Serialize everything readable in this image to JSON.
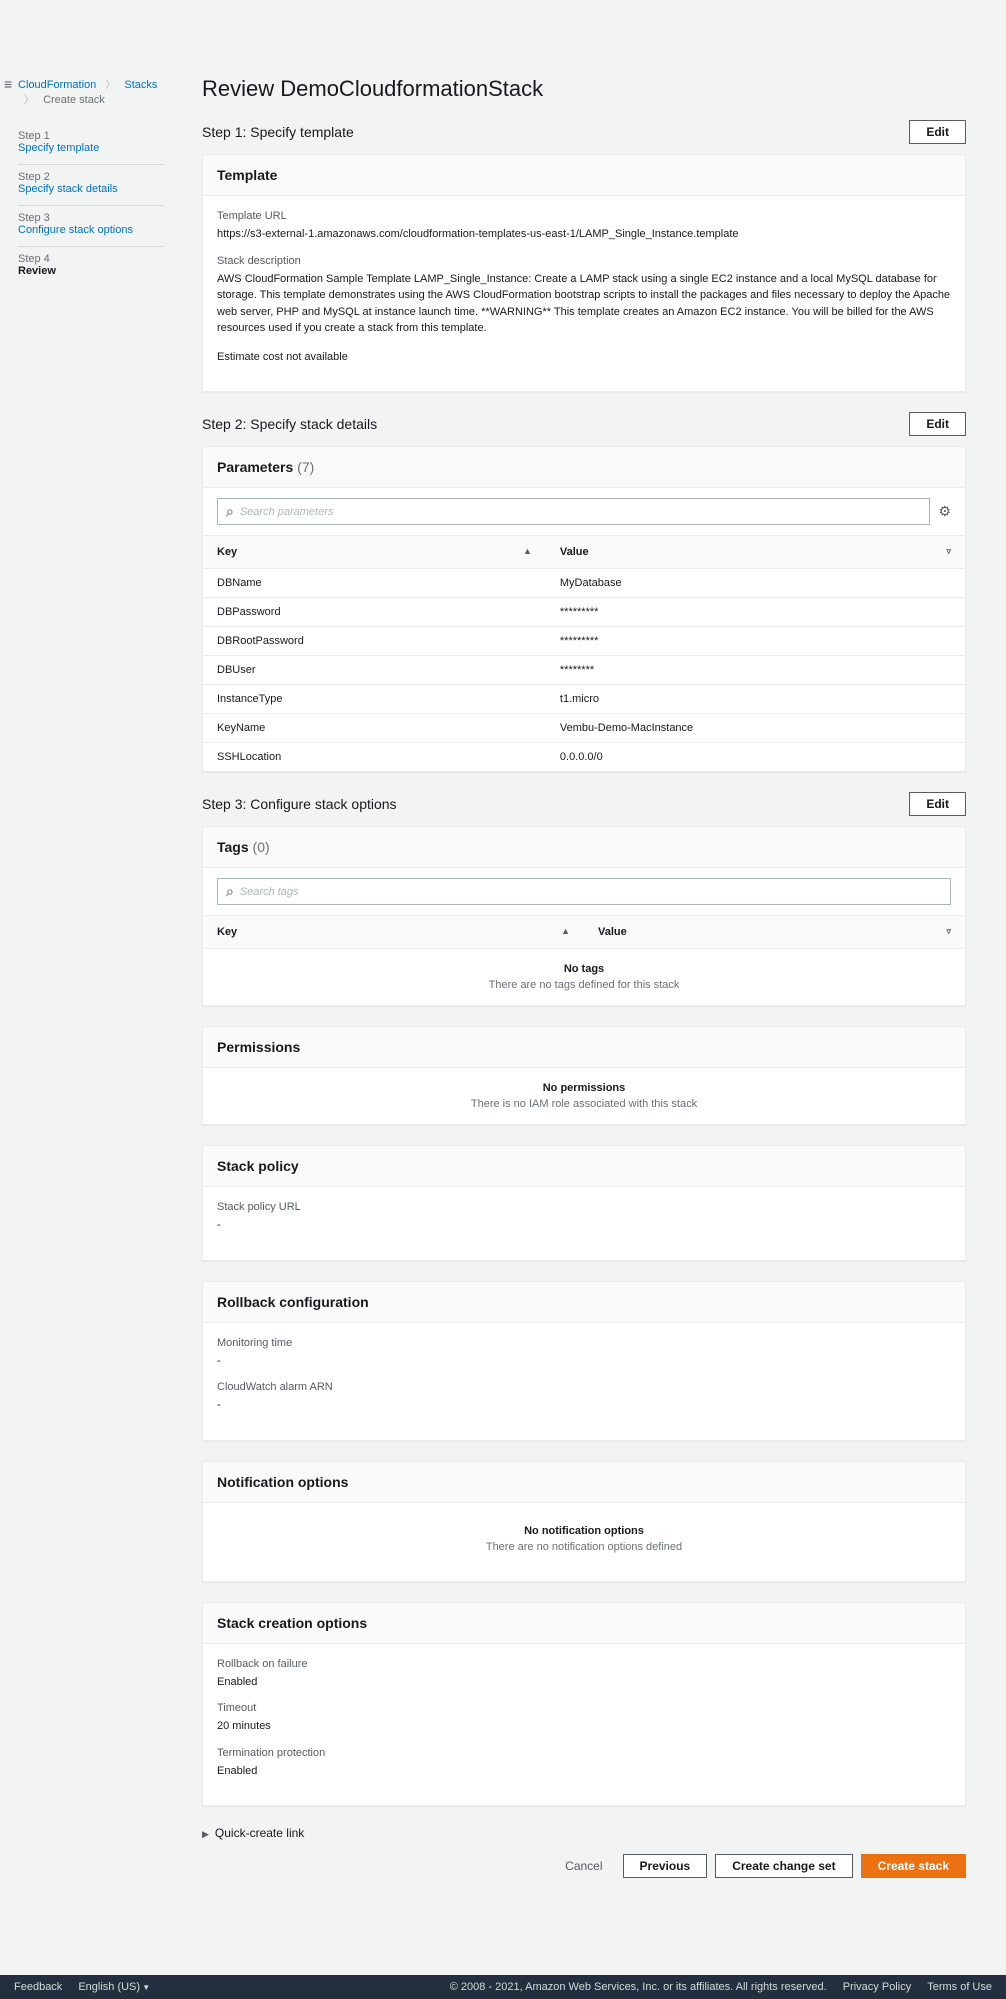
{
  "breadcrumb": {
    "cloudformation": "CloudFormation",
    "stacks": "Stacks",
    "current": "Create stack"
  },
  "steps": [
    {
      "num": "Step 1",
      "label": "Specify template"
    },
    {
      "num": "Step 2",
      "label": "Specify stack details"
    },
    {
      "num": "Step 3",
      "label": "Configure stack options"
    },
    {
      "num": "Step 4",
      "label": "Review"
    }
  ],
  "title": "Review DemoCloudformationStack",
  "step1": {
    "heading": "Step 1: Specify template",
    "edit": "Edit",
    "panel_title": "Template",
    "url_label": "Template URL",
    "url_value": "https://s3-external-1.amazonaws.com/cloudformation-templates-us-east-1/LAMP_Single_Instance.template",
    "desc_label": "Stack description",
    "desc_value": "AWS CloudFormation Sample Template LAMP_Single_Instance: Create a LAMP stack using a single EC2 instance and a local MySQL database for storage. This template demonstrates using the AWS CloudFormation bootstrap scripts to install the packages and files necessary to deploy the Apache web server, PHP and MySQL at instance launch time. **WARNING** This template creates an Amazon EC2 instance. You will be billed for the AWS resources used if you create a stack from this template.",
    "estimate": "Estimate cost not available"
  },
  "step2": {
    "heading": "Step 2: Specify stack details",
    "edit": "Edit",
    "panel_title": "Parameters",
    "count": "(7)",
    "search_placeholder": "Search parameters",
    "key_header": "Key",
    "value_header": "Value",
    "rows": [
      {
        "key": "DBName",
        "value": "MyDatabase"
      },
      {
        "key": "DBPassword",
        "value": "*********"
      },
      {
        "key": "DBRootPassword",
        "value": "*********"
      },
      {
        "key": "DBUser",
        "value": "********"
      },
      {
        "key": "InstanceType",
        "value": "t1.micro"
      },
      {
        "key": "KeyName",
        "value": "Vembu-Demo-MacInstance"
      },
      {
        "key": "SSHLocation",
        "value": "0.0.0.0/0"
      }
    ]
  },
  "step3": {
    "heading": "Step 3: Configure stack options",
    "edit": "Edit",
    "tags_title": "Tags",
    "tags_count": "(0)",
    "tags_search_placeholder": "Search tags",
    "key_header": "Key",
    "value_header": "Value",
    "no_tags_title": "No tags",
    "no_tags_sub": "There are no tags defined for this stack",
    "permissions_title": "Permissions",
    "no_perm_title": "No permissions",
    "no_perm_sub": "There is no IAM role associated with this stack",
    "stack_policy_title": "Stack policy",
    "stack_policy_label": "Stack policy URL",
    "stack_policy_value": "-",
    "rollback_title": "Rollback configuration",
    "monitoring_label": "Monitoring time",
    "monitoring_value": "-",
    "cw_label": "CloudWatch alarm ARN",
    "cw_value": "-",
    "notif_title": "Notification options",
    "no_notif_title": "No notification options",
    "no_notif_sub": "There are no notification options defined",
    "sco_title": "Stack creation options",
    "rof_label": "Rollback on failure",
    "rof_value": "Enabled",
    "timeout_label": "Timeout",
    "timeout_value": "20 minutes",
    "tp_label": "Termination protection",
    "tp_value": "Enabled"
  },
  "quick_create": "Quick-create link",
  "actions": {
    "cancel": "Cancel",
    "previous": "Previous",
    "change_set": "Create change set",
    "create": "Create stack"
  },
  "footer": {
    "feedback": "Feedback",
    "lang": "English (US)",
    "copyright": "© 2008 - 2021, Amazon Web Services, Inc. or its affiliates. All rights reserved.",
    "privacy": "Privacy Policy",
    "terms": "Terms of Use"
  }
}
